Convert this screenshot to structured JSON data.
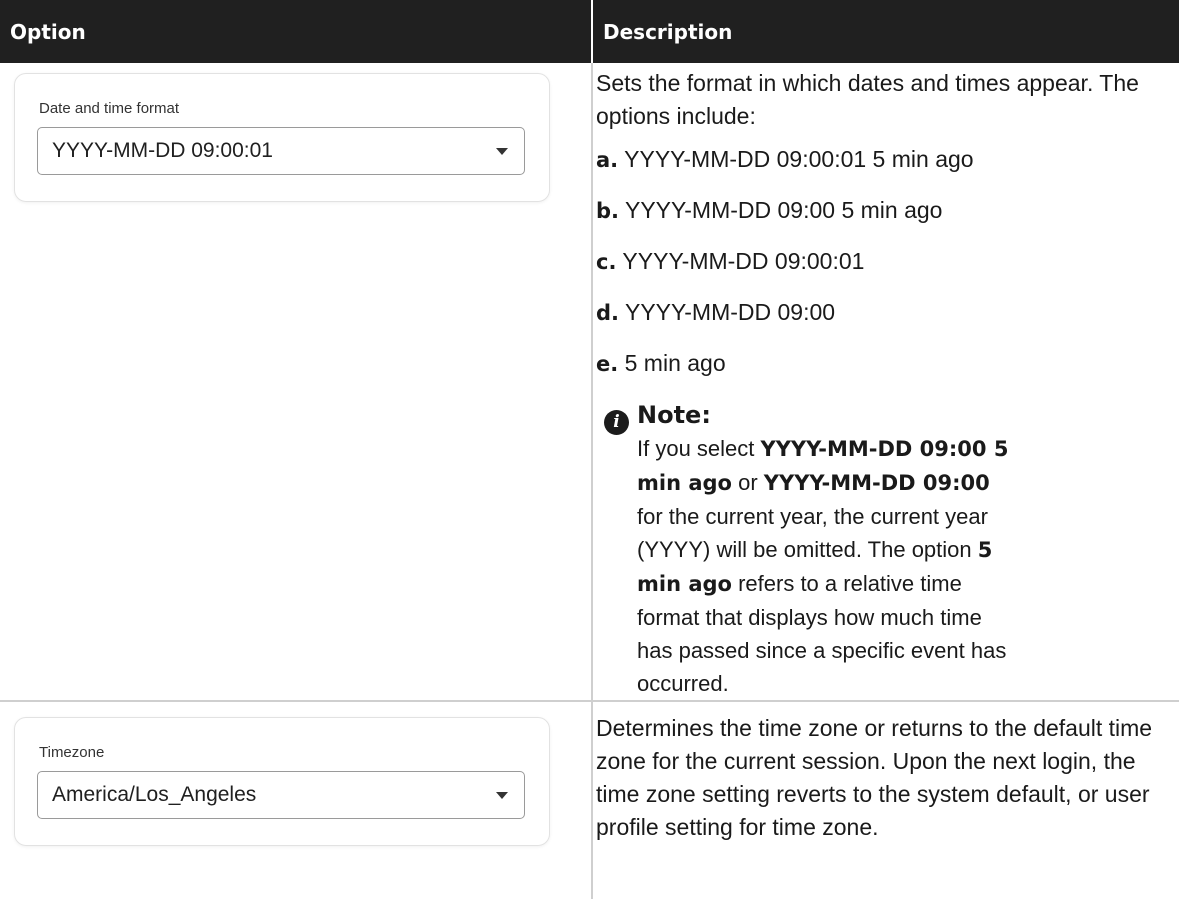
{
  "header": {
    "option": "Option",
    "description": "Description"
  },
  "rows": [
    {
      "field_label": "Date and time format",
      "field_value": "YYYY-MM-DD 09:00:01",
      "description": "Sets the format in which dates and times appear. The options include:",
      "options": [
        {
          "letter": "a.",
          "text": "YYYY-MM-DD 09:00:01 5 min ago"
        },
        {
          "letter": "b.",
          "text": "YYYY-MM-DD 09:00 5 min ago"
        },
        {
          "letter": "c.",
          "text": "YYYY-MM-DD 09:00:01"
        },
        {
          "letter": "d.",
          "text": "YYYY-MM-DD 09:00"
        },
        {
          "letter": "e.",
          "text": "5 min ago"
        }
      ],
      "note": {
        "title": "Note:",
        "t1": "If you select ",
        "b1": "YYYY-MM-DD 09:00 5 min ago",
        "t2": " or ",
        "b2": "YYYY-MM-DD 09:00",
        "t3": " for the current year, the current year (YYYY) will be omitted. The option ",
        "b3": "5 min ago",
        "t4": " refers to a relative time format that displays how much time has passed since a specific event has occurred."
      }
    },
    {
      "field_label": "Timezone",
      "field_value": "America/Los_Angeles",
      "description": "Determines the time zone or returns to the default time zone for the current session. Upon the next login, the time zone setting reverts to the system default, or user profile setting for time zone."
    }
  ],
  "icons": {
    "dropdown": "caret-down-icon",
    "note": "info-icon"
  }
}
